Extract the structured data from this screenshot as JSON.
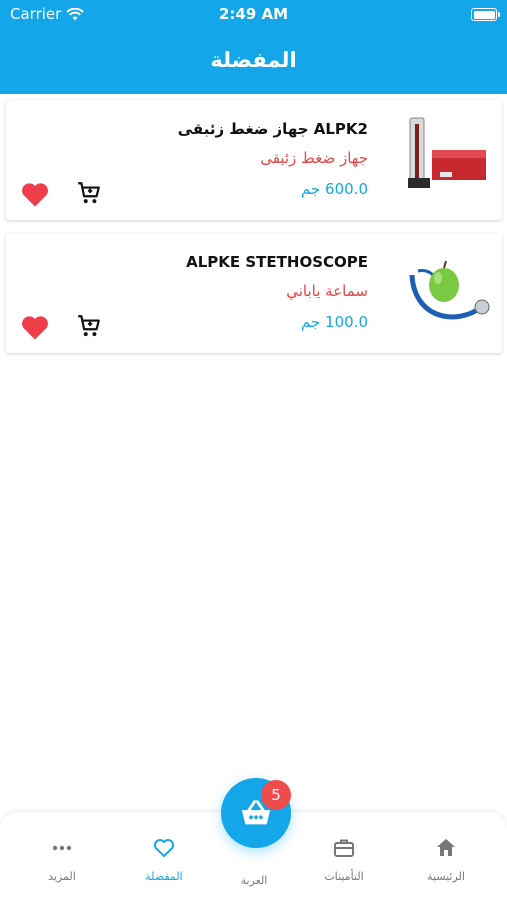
{
  "status_bar": {
    "carrier": "Carrier",
    "time": "2:49 AM"
  },
  "header": {
    "title": "المفضلة"
  },
  "favorites": [
    {
      "name": "ALPK2  جهاز ضغط زئبقى",
      "subtitle": "جهاز ضغط زئبقى",
      "price": "600.0 جم"
    },
    {
      "name": "ALPKE STETHOSCOPE",
      "subtitle": "سماعة ياباني",
      "price": "100.0 جم"
    }
  ],
  "tabbar": {
    "home": "الرئيسية",
    "insurance": "التأمينات",
    "cart": "العربة",
    "favorites": "المفضلة",
    "more": "المزيد",
    "cart_count": "5"
  },
  "colors": {
    "primary": "#13a7ea",
    "accent_red": "#e84545",
    "badge": "#ee4b4b"
  }
}
